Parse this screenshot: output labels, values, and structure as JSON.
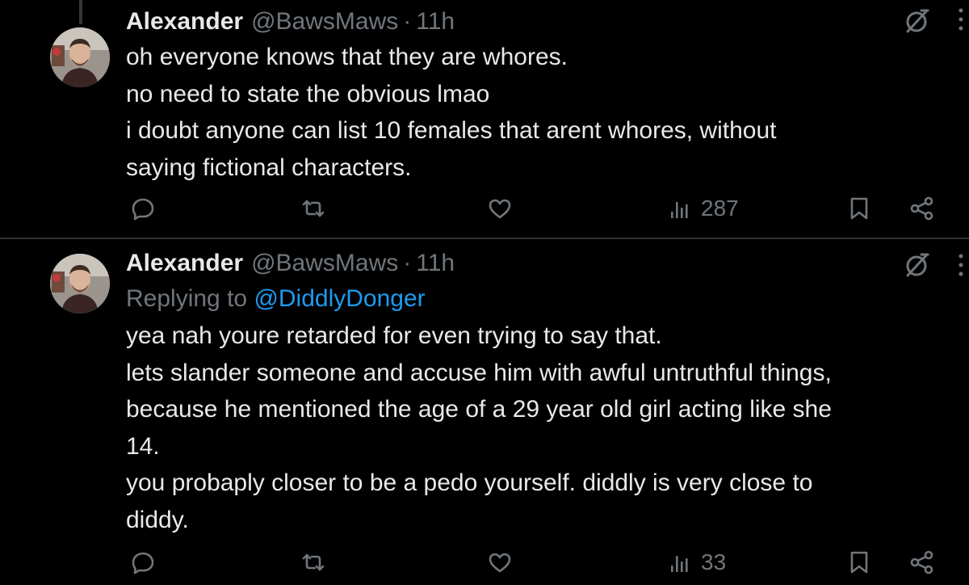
{
  "tweets": [
    {
      "name": "Alexander",
      "handle": "@BawsMaws",
      "separator": "·",
      "time": "11h",
      "lines": [
        "oh everyone knows that they are whores.",
        "no need to state the obvious lmao",
        "i doubt anyone can list 10 females that arent whores, without",
        "saying fictional characters."
      ],
      "views": "287"
    },
    {
      "name": "Alexander",
      "handle": "@BawsMaws",
      "separator": "·",
      "time": "11h",
      "replying_prefix": "Replying to ",
      "replying_to": "@DiddlyDonger",
      "lines": [
        "yea nah youre retarded for even trying to say that.",
        "lets slander someone and accuse him with awful untruthful things,",
        "because he mentioned the age of a 29 year old girl acting like she",
        "14.",
        "you probaply closer to be a pedo yourself. diddly is very close to",
        "diddy."
      ],
      "views": "33"
    }
  ],
  "icons": {
    "reply": "reply-icon",
    "repost": "repost-icon",
    "like": "like-icon",
    "views": "views-icon",
    "bookmark": "bookmark-icon",
    "share": "share-icon",
    "grok": "grok-icon",
    "more": "more-icon"
  },
  "colors": {
    "background": "#000000",
    "text": "#e7e9ea",
    "muted": "#71767b",
    "link": "#1d9bf0",
    "divider": "#2f3336"
  }
}
